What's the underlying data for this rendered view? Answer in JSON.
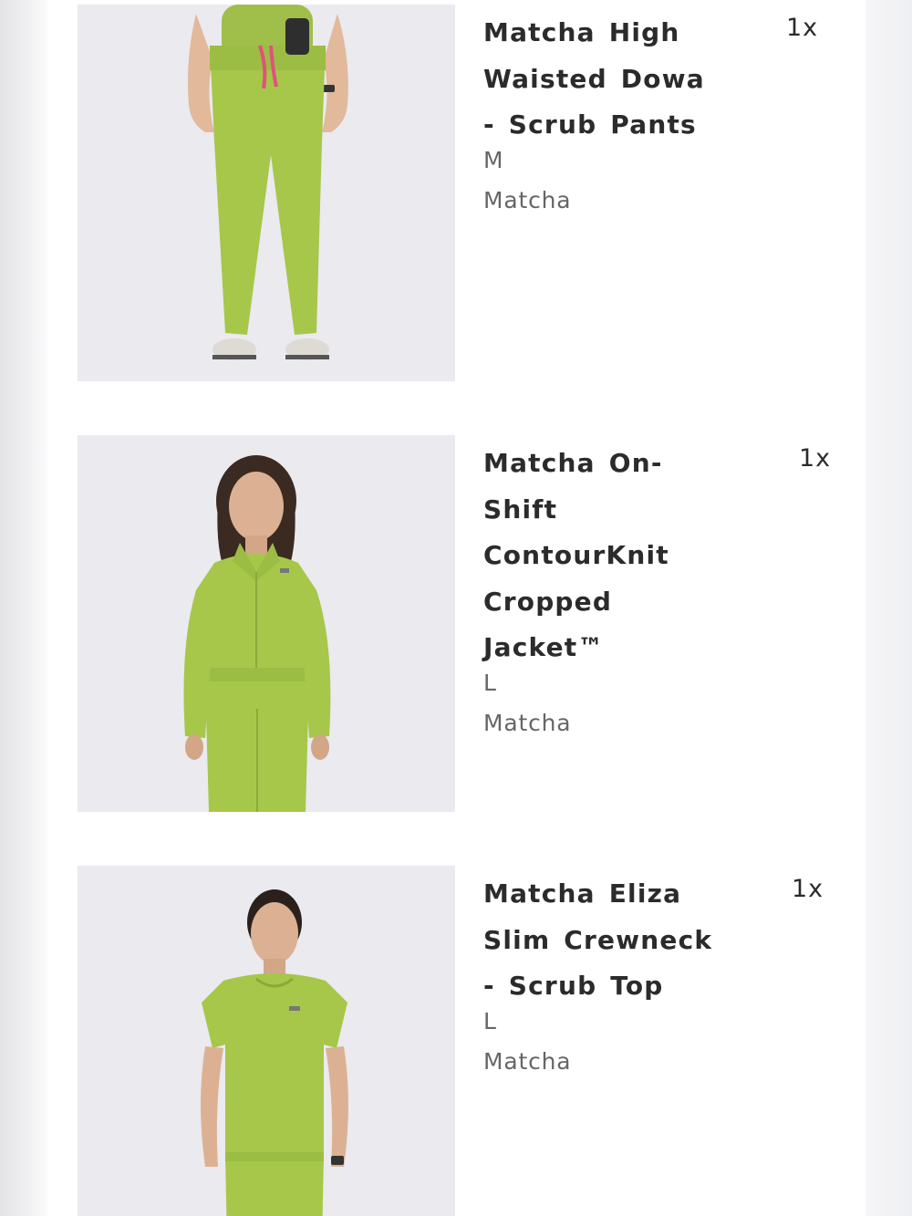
{
  "cart": {
    "items": [
      {
        "name_lines": [
          "Matcha High",
          "Waisted Dowa",
          "- Scrub Pants"
        ],
        "quantity": "1x",
        "size": "M",
        "color": "Matcha",
        "image": "product-photo-scrub-pants"
      },
      {
        "name_lines": [
          "Matcha On-",
          "Shift",
          "ContourKnit",
          "Cropped",
          "Jacket™"
        ],
        "quantity": "1x",
        "size": "L",
        "color": "Matcha",
        "image": "product-photo-cropped-jacket"
      },
      {
        "name_lines": [
          "Matcha Eliza",
          "Slim Crewneck",
          "- Scrub Top"
        ],
        "quantity": "1x",
        "size": "L",
        "color": "Matcha",
        "image": "product-photo-scrub-top"
      }
    ]
  },
  "colors": {
    "matcha": "#a6c74a",
    "photo_background": "#eaeaef",
    "text_primary": "#2b2b2b",
    "text_secondary": "#666666"
  }
}
